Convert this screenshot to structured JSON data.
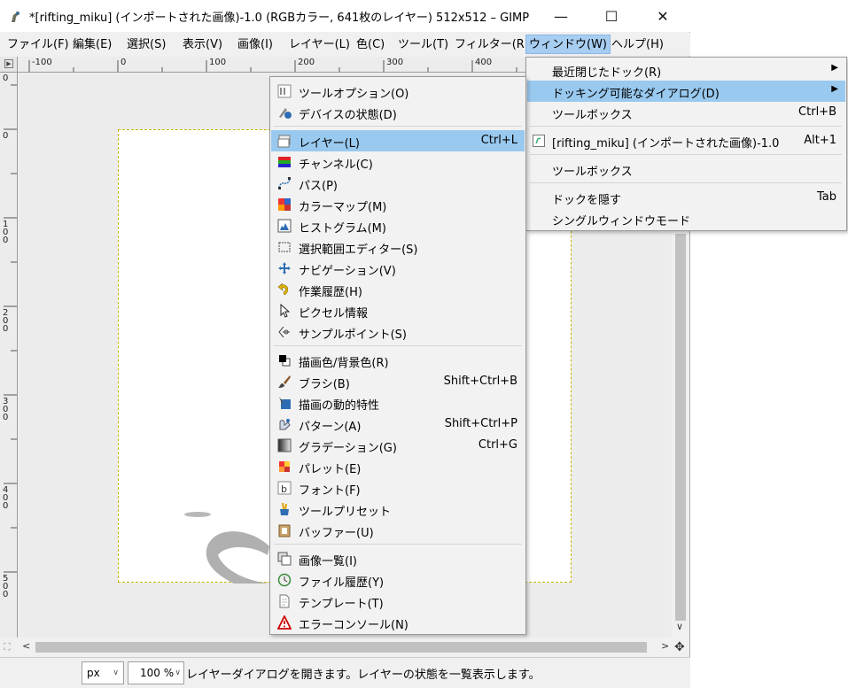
{
  "window": {
    "title": "*[rifting_miku] (インポートされた画像)-1.0 (RGBカラー, 641枚のレイヤー) 512x512 – GIMP",
    "minimize": "—",
    "maximize": "☐",
    "close": "✕"
  },
  "menubar": [
    "ファイル(F)",
    "編集(E)",
    "選択(S)",
    "表示(V)",
    "画像(I)",
    "レイヤー(L)",
    "色(C)",
    "ツール(T)",
    "フィルター(R)",
    "ウィンドウ(W)",
    "ヘルプ(H)"
  ],
  "rulers": {
    "horizontal": [
      "-100",
      "0",
      "100",
      "200",
      "300",
      "400"
    ],
    "vertical": [
      "0",
      "0",
      "100",
      "200",
      "300",
      "400",
      "500"
    ]
  },
  "window_menu": {
    "items": [
      {
        "label": "最近閉じたドック(R)",
        "submenu": true
      },
      {
        "label": "ドッキング可能なダイアログ(D)",
        "submenu": true,
        "highlighted": true
      },
      {
        "label": "ツールボックス",
        "shortcut": "Ctrl+B"
      },
      {
        "label": "[rifting_miku] (インポートされた画像)-1.0",
        "shortcut": "Alt+1"
      },
      {
        "label": "ツールボックス"
      },
      {
        "label": "ドックを隠す",
        "shortcut": "Tab"
      },
      {
        "label": "シングルウィンドウモード"
      }
    ]
  },
  "dockable_dialogs": {
    "items": [
      {
        "label": "ツールオプション(O)",
        "icon": "tool-options-icon"
      },
      {
        "label": "デバイスの状態(D)",
        "icon": "device-status-icon"
      },
      {
        "label": "レイヤー(L)",
        "shortcut": "Ctrl+L",
        "highlighted": true,
        "icon": "layers-icon"
      },
      {
        "label": "チャンネル(C)",
        "icon": "channels-icon"
      },
      {
        "label": "パス(P)",
        "icon": "paths-icon"
      },
      {
        "label": "カラーマップ(M)",
        "icon": "colormap-icon"
      },
      {
        "label": "ヒストグラム(M)",
        "icon": "histogram-icon"
      },
      {
        "label": "選択範囲エディター(S)",
        "icon": "selection-editor-icon"
      },
      {
        "label": "ナビゲーション(V)",
        "icon": "navigation-icon"
      },
      {
        "label": "作業履歴(H)",
        "icon": "undo-history-icon"
      },
      {
        "label": "ピクセル情報",
        "icon": "pointer-info-icon"
      },
      {
        "label": "サンプルポイント(S)",
        "icon": "sample-points-icon"
      },
      {
        "label": "描画色/背景色(R)",
        "icon": "fg-bg-colors-icon"
      },
      {
        "label": "ブラシ(B)",
        "shortcut": "Shift+Ctrl+B",
        "icon": "brushes-icon"
      },
      {
        "label": "描画の動的特性",
        "icon": "paint-dynamics-icon"
      },
      {
        "label": "パターン(A)",
        "shortcut": "Shift+Ctrl+P",
        "icon": "patterns-icon"
      },
      {
        "label": "グラデーション(G)",
        "shortcut": "Ctrl+G",
        "icon": "gradients-icon"
      },
      {
        "label": "パレット(E)",
        "icon": "palettes-icon"
      },
      {
        "label": "フォント(F)",
        "icon": "fonts-icon"
      },
      {
        "label": "ツールプリセット",
        "icon": "tool-presets-icon"
      },
      {
        "label": "バッファー(U)",
        "icon": "buffers-icon"
      },
      {
        "label": "画像一覧(I)",
        "icon": "images-icon"
      },
      {
        "label": "ファイル履歴(Y)",
        "icon": "document-history-icon"
      },
      {
        "label": "テンプレート(T)",
        "icon": "templates-icon"
      },
      {
        "label": "エラーコンソール(N)",
        "icon": "error-console-icon"
      }
    ]
  },
  "statusbar": {
    "unit": "px",
    "zoom": "100 %",
    "message": "レイヤーダイアログを開きます。レイヤーの状態を一覧表示します。"
  },
  "colors": {
    "highlight": "#99c9ef",
    "menu_active": "#a7cdf1",
    "selection_border": "#c8b400"
  }
}
